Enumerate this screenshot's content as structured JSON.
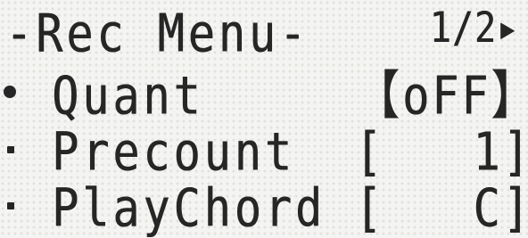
{
  "menu": {
    "title": "-Rec Menu-",
    "page_indicator": "1/2▸",
    "selected_index": 0,
    "items": [
      {
        "label": "Quant",
        "value": "【oFF】"
      },
      {
        "label": "Precount",
        "value": "[   1]"
      },
      {
        "label": "PlayChord",
        "value": "[   C]"
      }
    ]
  },
  "colors": {
    "lcd_background": "#f4f4f2",
    "lcd_text": "#262626"
  }
}
